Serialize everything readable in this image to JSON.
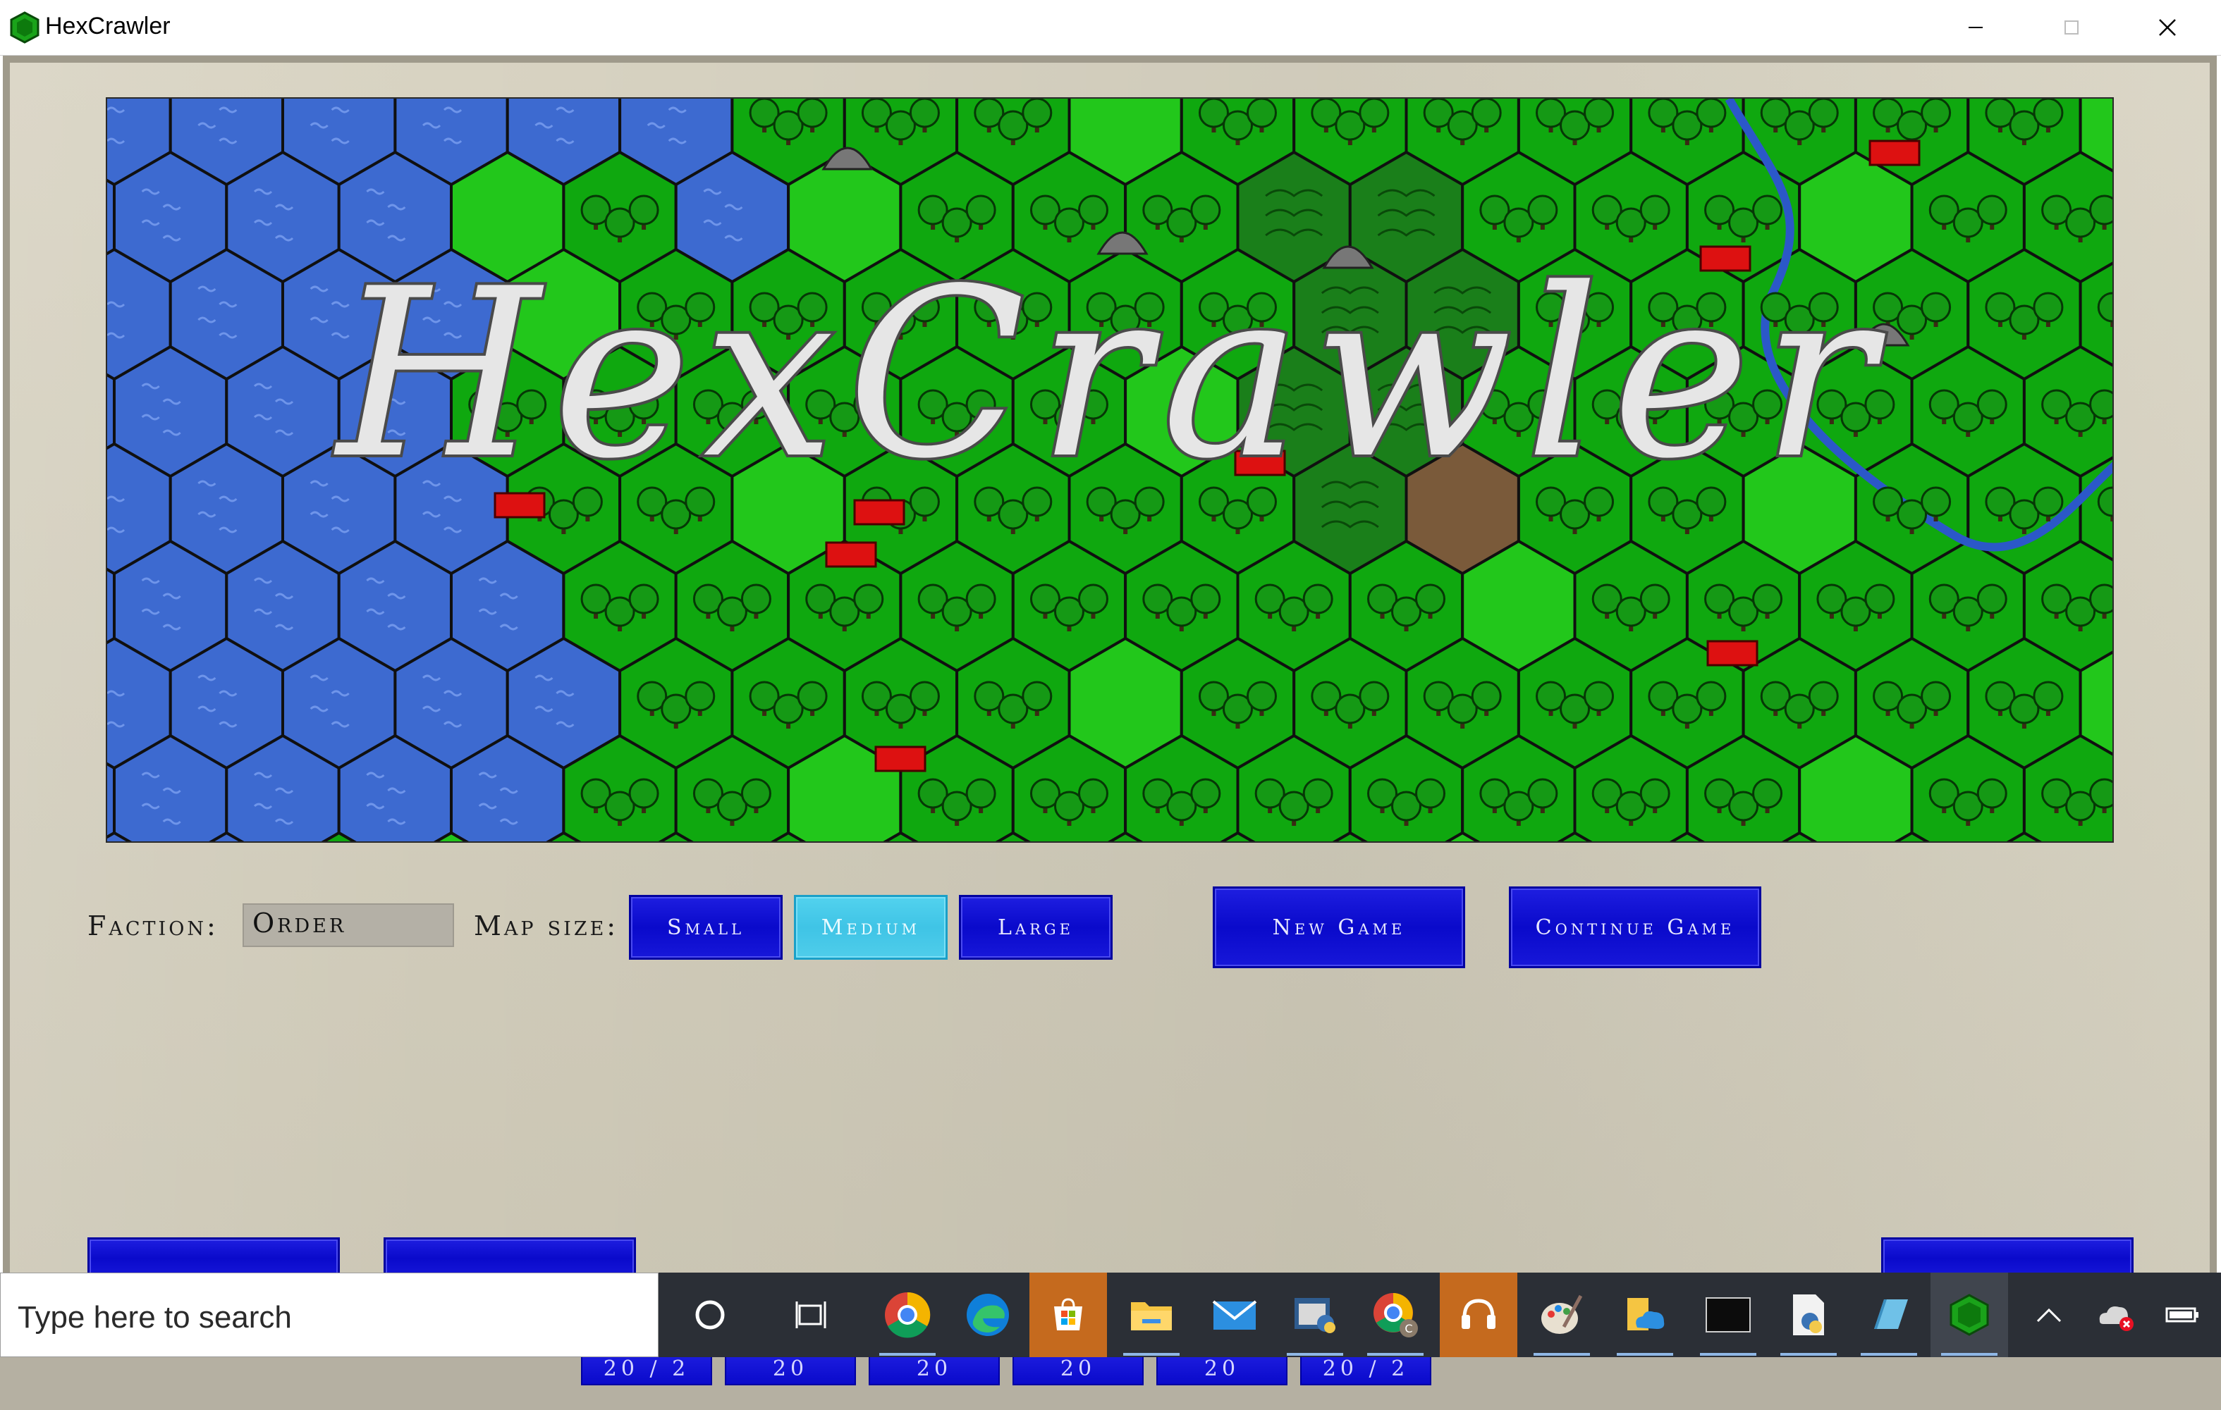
{
  "window": {
    "title": "HexCrawler",
    "app_icon": "green-hex-icon",
    "controls": [
      "minimize-icon",
      "maximize-icon",
      "close-icon"
    ]
  },
  "banner": {
    "logo_text": "HexCrawler",
    "colors": {
      "water": "#3d6ad0",
      "grass": "#22c71b",
      "forest": "#0fa80f",
      "hills": "#1a7f1a",
      "mountain": "#7a5a3a",
      "river": "#2b58c8"
    }
  },
  "controls": {
    "faction_label": "Faction:",
    "faction_value": "Order",
    "map_size_label": "Map size:",
    "map_sizes": [
      {
        "label": "Small",
        "selected": false
      },
      {
        "label": "Medium",
        "selected": true
      },
      {
        "label": "Large",
        "selected": false
      }
    ],
    "new_game": "New Game",
    "continue_game": "Continue Game"
  },
  "taskbar": {
    "search_placeholder": "Type here to search",
    "icons": [
      "cortana-icon",
      "task-view-icon",
      "chrome-icon",
      "edge-icon",
      "store-icon",
      "file-explorer-icon",
      "mail-icon",
      "python-idle-icon",
      "chrome-profile-icon",
      "audio-icon",
      "paint-icon",
      "onedrive-folder-icon",
      "terminal-icon",
      "python-file-icon",
      "notepad-icon",
      "hexcrawler-icon",
      "show-hidden-icons",
      "onedrive-error-icon",
      "battery-icon"
    ]
  },
  "background_window": {
    "buttons": [
      "20 / 2",
      "20",
      "20",
      "20",
      "20",
      "20 / 2"
    ]
  }
}
